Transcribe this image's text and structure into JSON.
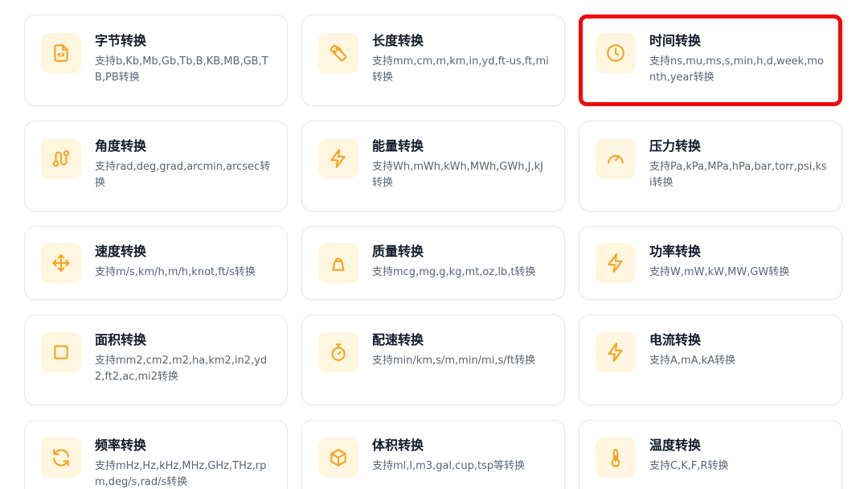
{
  "accent_color": "#f5a524",
  "icon_bg_color": "#fff6e0",
  "highlight_color": "#ee0a0a",
  "cards": [
    {
      "title": "字节转换",
      "desc": "支持b,Kb,Mb,Gb,Tb,B,KB,MB,GB,TB,PB转换",
      "icon": "file-code-icon"
    },
    {
      "title": "长度转换",
      "desc": "支持mm,cm,m,km,in,yd,ft-us,ft,mi转换",
      "icon": "ruler-icon"
    },
    {
      "title": "时间转换",
      "desc": "支持ns,mu,ms,s,min,h,d,week,month,year转换",
      "icon": "clock-icon",
      "selected": true
    },
    {
      "title": "角度转换",
      "desc": "支持rad,deg,grad,arcmin,arcsec转换",
      "icon": "route-icon"
    },
    {
      "title": "能量转换",
      "desc": "支持Wh,mWh,kWh,MWh,GWh,J,kJ转换",
      "icon": "lightning-icon"
    },
    {
      "title": "压力转换",
      "desc": "支持Pa,kPa,MPa,hPa,bar,torr,psi,ksi转换",
      "icon": "gauge-icon"
    },
    {
      "title": "速度转换",
      "desc": "支持m/s,km/h,m/h,knot,ft/s转换",
      "icon": "move-arrows-icon"
    },
    {
      "title": "质量转换",
      "desc": "支持mcg,mg,g,kg,mt,oz,lb,t转换",
      "icon": "weight-icon"
    },
    {
      "title": "功率转换",
      "desc": "支持W,mW,kW,MW,GW转换",
      "icon": "lightning-icon"
    },
    {
      "title": "面积转换",
      "desc": "支持mm2,cm2,m2,ha,km2,in2,yd2,ft2,ac,mi2转换",
      "icon": "square-icon"
    },
    {
      "title": "配速转换",
      "desc": "支持min/km,s/m,min/mi,s/ft转换",
      "icon": "stopwatch-icon"
    },
    {
      "title": "电流转换",
      "desc": "支持A,mA,kA转换",
      "icon": "lightning-icon"
    },
    {
      "title": "频率转换",
      "desc": "支持mHz,Hz,kHz,MHz,GHz,THz,rpm,deg/s,rad/s转换",
      "icon": "refresh-icon"
    },
    {
      "title": "体积转换",
      "desc": "支持ml,l,m3,gal,cup,tsp等转换",
      "icon": "cube-icon"
    },
    {
      "title": "温度转换",
      "desc": "支持C,K,F,R转换",
      "icon": "thermometer-icon"
    }
  ]
}
